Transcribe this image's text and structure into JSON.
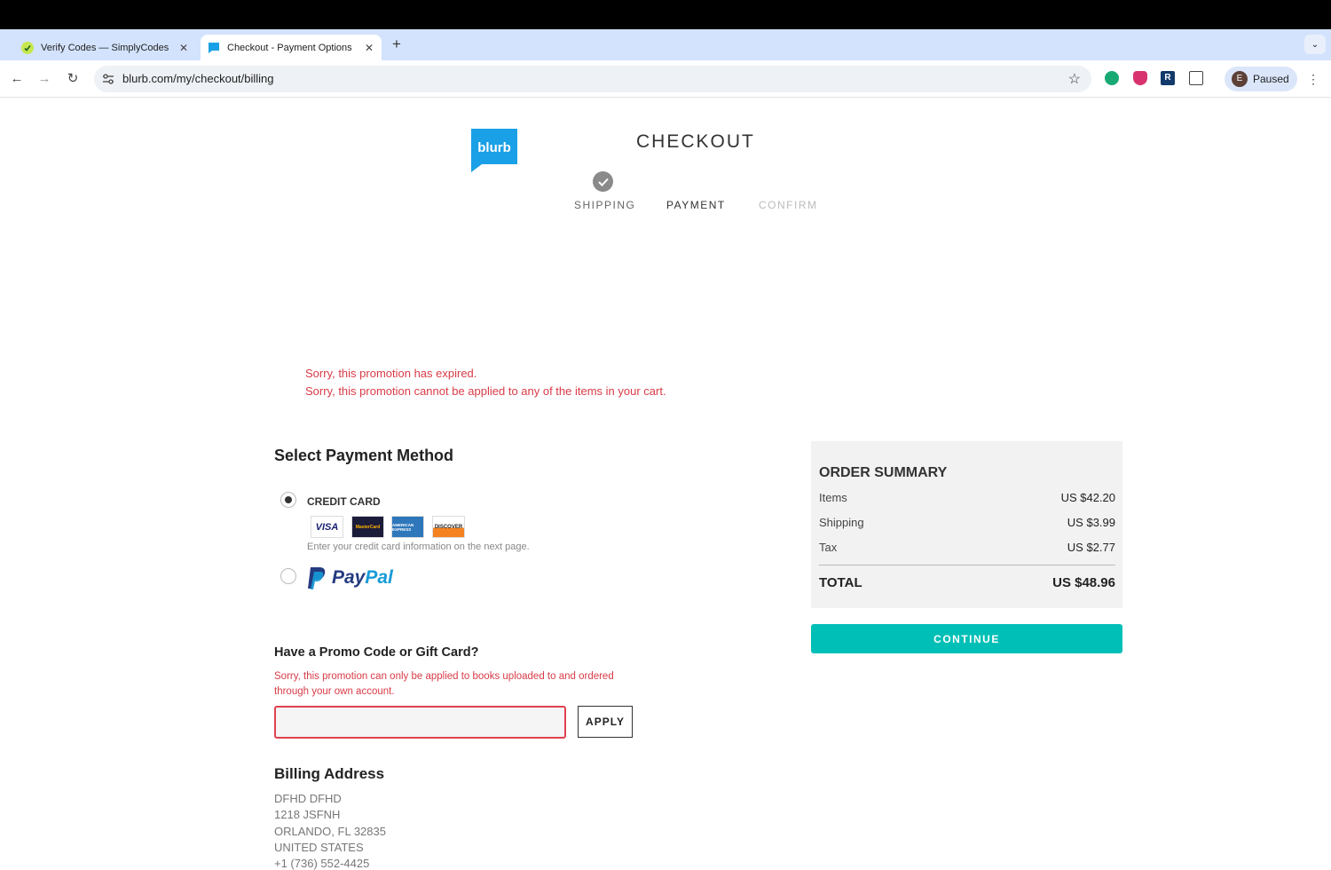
{
  "browser": {
    "tabs": [
      {
        "title": "Verify Codes — SimplyCodes",
        "active": false
      },
      {
        "title": "Checkout - Payment Options",
        "active": true
      }
    ],
    "url": "blurb.com/my/checkout/billing",
    "profile": {
      "initial": "E",
      "label": "Paused"
    }
  },
  "brand": {
    "logo_text": "blurb",
    "color": "#1aa0e6"
  },
  "header": {
    "title": "CHECKOUT"
  },
  "steps": [
    {
      "label": "SHIPPING",
      "state": "done"
    },
    {
      "label": "PAYMENT",
      "state": "current"
    },
    {
      "label": "CONFIRM",
      "state": "upcoming"
    }
  ],
  "errors": [
    "Sorry, this promotion has expired.",
    "Sorry, this promotion cannot be applied to any of the items in your cart."
  ],
  "payment": {
    "heading": "Select Payment Method",
    "credit_card_label": "CREDIT CARD",
    "card_logos": [
      "VISA",
      "MasterCard",
      "AMERICAN EXPRESS",
      "DISCOVER"
    ],
    "credit_card_note": "Enter your credit card information on the next page.",
    "paypal_word1": "Pay",
    "paypal_word2": "Pal",
    "selected": "credit_card"
  },
  "promo": {
    "heading": "Have a Promo Code or Gift Card?",
    "error": "Sorry, this promotion can only be applied to books uploaded to and ordered through your own account.",
    "value": "",
    "apply_label": "APPLY"
  },
  "billing": {
    "heading": "Billing Address",
    "lines": [
      "DFHD DFHD",
      "1218 JSFNH",
      "ORLANDO, FL 32835",
      "UNITED STATES",
      "+1 (736) 552-4425"
    ]
  },
  "summary": {
    "title": "ORDER SUMMARY",
    "rows": [
      {
        "label": "Items",
        "value": "US $42.20"
      },
      {
        "label": "Shipping",
        "value": "US $3.99"
      },
      {
        "label": "Tax",
        "value": "US $2.77"
      }
    ],
    "total_label": "TOTAL",
    "total_value": "US $48.96",
    "continue_label": "CONTINUE"
  },
  "colors": {
    "accent": "#00bfb6",
    "error": "#d93b47"
  }
}
